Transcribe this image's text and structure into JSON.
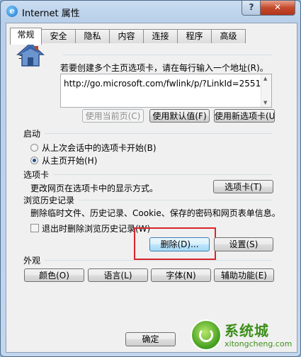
{
  "window": {
    "title": "Internet 属性",
    "help_label": "?",
    "close_label": "✕"
  },
  "tabs": [
    {
      "label": "常规",
      "active": true
    },
    {
      "label": "安全"
    },
    {
      "label": "隐私"
    },
    {
      "label": "内容"
    },
    {
      "label": "连接"
    },
    {
      "label": "程序"
    },
    {
      "label": "高级"
    }
  ],
  "homepage": {
    "group_label": "主页",
    "instruction": "若要创建多个主页选项卡，请在每行输入一个地址(R)。",
    "url": "http://go.microsoft.com/fwlink/p/?LinkId=2551",
    "buttons": {
      "use_current": "使用当前页(C)",
      "use_default": "使用默认值(F)",
      "use_new_tab": "使用新选项卡(U)"
    }
  },
  "startup": {
    "group_label": "启动",
    "option_last_session": "从上次会话中的选项卡开始(B)",
    "option_homepage": "从主页开始(H)",
    "selected": "homepage"
  },
  "tabs_section": {
    "group_label": "选项卡",
    "description": "更改网页在选项卡中的显示方式。",
    "button": "选项卡(T)"
  },
  "history": {
    "group_label": "浏览历史记录",
    "description": "删除临时文件、历史记录、Cookie、保存的密码和网页表单信息。",
    "checkbox_label": "退出时删除浏览历史记录(W)",
    "checked": false,
    "delete_button": "删除(D)...",
    "settings_button": "设置(S)"
  },
  "appearance": {
    "group_label": "外观",
    "buttons": {
      "colors": "颜色(O)",
      "languages": "语言(L)",
      "fonts": "字体(N)",
      "accessibility": "辅助功能(E)"
    }
  },
  "dialog_buttons": {
    "ok": "确定"
  },
  "watermark": {
    "title": "系统城",
    "site": "xitongcheng.com"
  },
  "colors": {
    "highlight_box": "#d8262b",
    "title_bar": "#c2d6ee",
    "close_button": "#c44a2c"
  }
}
